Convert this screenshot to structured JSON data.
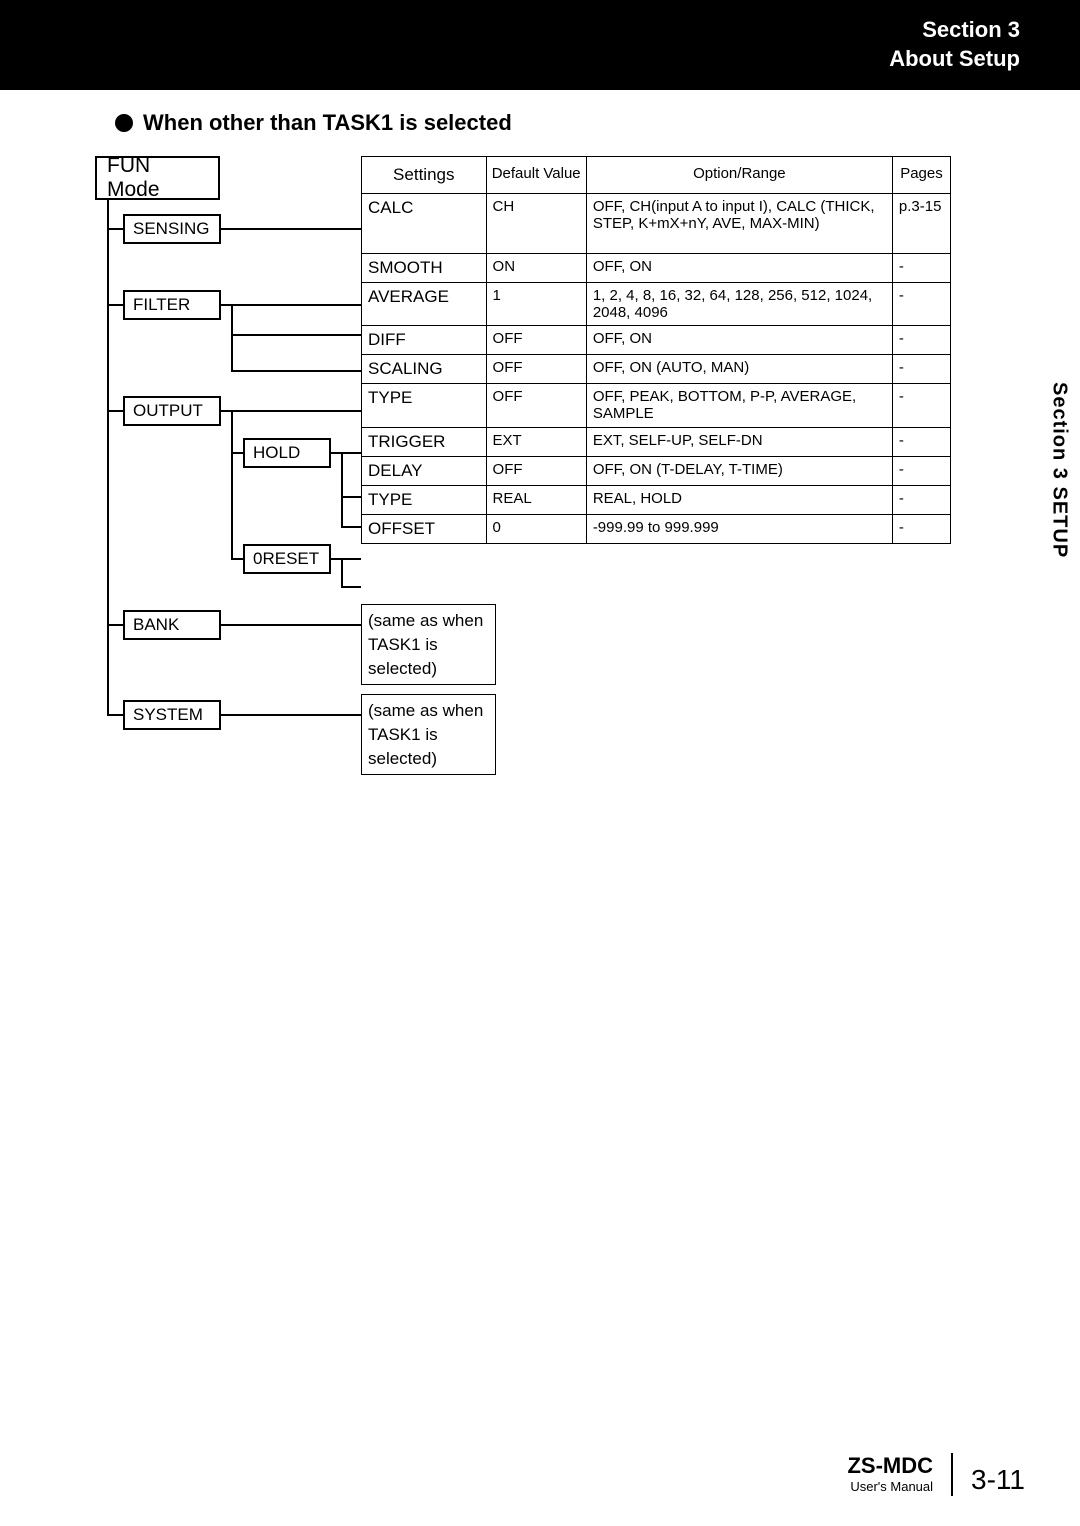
{
  "header": {
    "line1": "Section 3",
    "line2": "About Setup"
  },
  "title": "When other than TASK1 is selected",
  "fun_mode": "FUN Mode",
  "tree": {
    "sensing": "SENSING",
    "filter": "FILTER",
    "output": "OUTPUT",
    "hold": "HOLD",
    "reset": "0RESET",
    "bank": "BANK",
    "system": "SYSTEM"
  },
  "table_headers": {
    "settings": "Settings",
    "default": "Default Value",
    "option": "Option/Range",
    "pages": "Pages"
  },
  "rows": [
    {
      "setting": "CALC",
      "default": "CH",
      "option": "OFF, CH(input A to input I), CALC (THICK, STEP, K+mX+nY, AVE, MAX-MIN)",
      "page": "p.3-15"
    },
    {
      "setting": "SMOOTH",
      "default": "ON",
      "option": "OFF, ON",
      "page": "-"
    },
    {
      "setting": "AVERAGE",
      "default": "1",
      "option": "1, 2, 4, 8, 16, 32, 64, 128, 256, 512, 1024, 2048, 4096",
      "page": "-"
    },
    {
      "setting": "DIFF",
      "default": "OFF",
      "option": "OFF, ON",
      "page": "-"
    },
    {
      "setting": "SCALING",
      "default": "OFF",
      "option": "OFF, ON (AUTO, MAN)",
      "page": "-"
    },
    {
      "setting": "TYPE",
      "default": "OFF",
      "option": "OFF, PEAK, BOTTOM, P-P, AVERAGE, SAMPLE",
      "page": "-"
    },
    {
      "setting": "TRIGGER",
      "default": "EXT",
      "option": "EXT, SELF-UP, SELF-DN",
      "page": "-"
    },
    {
      "setting": "DELAY",
      "default": "OFF",
      "option": "OFF, ON (T-DELAY, T-TIME)",
      "page": "-"
    },
    {
      "setting": "TYPE",
      "default": "REAL",
      "option": "REAL, HOLD",
      "page": "-"
    },
    {
      "setting": "OFFSET",
      "default": "0",
      "option": "-999.99 to 999.999",
      "page": "-"
    }
  ],
  "notes": {
    "bank": "(same as when TASK1 is selected)",
    "system": "(same as when TASK1 is selected)"
  },
  "side_tab": "Section 3   SETUP",
  "footer": {
    "doc": "ZS-MDC",
    "sub": "User's Manual",
    "page": "3-11"
  }
}
